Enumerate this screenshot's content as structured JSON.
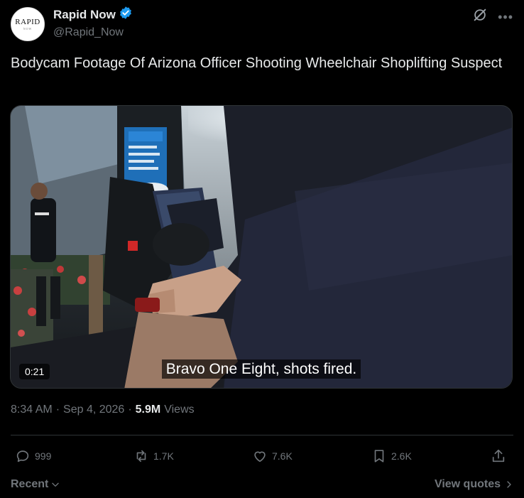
{
  "author": {
    "name": "Rapid Now",
    "handle": "@Rapid_Now",
    "avatar_text": "RAPID",
    "avatar_subtext": "NOW",
    "verified_color": "#1d9bf0"
  },
  "tweet": {
    "text": "Bodycam Footage Of Arizona Officer Shooting Wheelchair Shoplifting Suspect"
  },
  "media": {
    "duration": "0:21",
    "caption": "Bravo One Eight, shots fired."
  },
  "meta": {
    "time": "8:34 AM",
    "separator": "·",
    "date": "Sep 4, 2026",
    "views_count": "5.9M",
    "views_label": "Views"
  },
  "actions": {
    "replies": "999",
    "reposts": "1.7K",
    "likes": "7.6K",
    "bookmarks": "2.6K"
  },
  "footer": {
    "sort_label": "Recent",
    "quotes_label": "View quotes"
  },
  "icons": {
    "verified": "verified-badge-icon",
    "grok": "grok-icon",
    "more": "more-icon",
    "reply": "reply-icon",
    "repost": "repost-icon",
    "like": "heart-icon",
    "bookmark": "bookmark-icon",
    "share": "share-icon"
  }
}
